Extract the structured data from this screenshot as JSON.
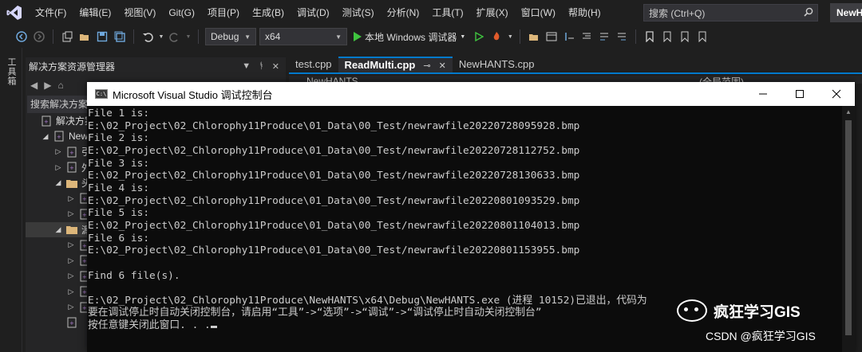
{
  "menubar": {
    "items": [
      "文件(F)",
      "编辑(E)",
      "视图(V)",
      "Git(G)",
      "项目(P)",
      "生成(B)",
      "调试(D)",
      "测试(S)",
      "分析(N)",
      "工具(T)",
      "扩展(X)",
      "窗口(W)",
      "帮助(H)"
    ],
    "search_placeholder": "搜索 (Ctrl+Q)",
    "solution_name": "NewHANTS"
  },
  "toolbar": {
    "config": "Debug",
    "platform": "x64",
    "run_label": "本地 Windows 调试器",
    "icons": [
      "back-icon",
      "forward-icon",
      "new-project-icon",
      "open-icon",
      "save-icon",
      "save-all-icon",
      "undo-icon",
      "redo-icon",
      "start-icon",
      "start-without-debug-icon",
      "hot-reload-icon",
      "bookmark-icon"
    ]
  },
  "left_strip": {
    "label": "工具箱"
  },
  "solution_explorer": {
    "title": "解决方案资源管理器",
    "search_label": "搜索解决方案资源管",
    "tree": [
      {
        "label": "解决方案'",
        "expand": "",
        "indent": 0,
        "selected": false
      },
      {
        "label": "New",
        "expand": "◢",
        "indent": 1,
        "selected": false
      },
      {
        "label": "引",
        "expand": "▷",
        "indent": 2,
        "selected": false
      },
      {
        "label": "外",
        "expand": "▷",
        "indent": 2,
        "selected": false
      },
      {
        "label": "头",
        "expand": "◢",
        "indent": 2,
        "selected": false
      },
      {
        "label": "",
        "expand": "▷",
        "indent": 3,
        "selected": false
      },
      {
        "label": "",
        "expand": "▷",
        "indent": 3,
        "selected": false
      },
      {
        "label": "源",
        "expand": "◢",
        "indent": 2,
        "selected": true
      },
      {
        "label": "",
        "expand": "▷",
        "indent": 3,
        "selected": false
      },
      {
        "label": "",
        "expand": "▷",
        "indent": 3,
        "selected": false
      },
      {
        "label": "",
        "expand": "▷",
        "indent": 3,
        "selected": false
      },
      {
        "label": "",
        "expand": "▷",
        "indent": 3,
        "selected": false
      },
      {
        "label": "",
        "expand": "▷",
        "indent": 3,
        "selected": false
      },
      {
        "label": "",
        "expand": "",
        "indent": 2,
        "selected": false
      }
    ]
  },
  "editor": {
    "tabs": [
      {
        "label": "test.cpp",
        "active": false
      },
      {
        "label": "ReadMulti.cpp",
        "active": true
      },
      {
        "label": "NewHANTS.cpp",
        "active": false
      }
    ],
    "project_label": "NewHANTS",
    "scope_label": "(全局范围)"
  },
  "console": {
    "title": "Microsoft Visual Studio 调试控制台",
    "icon_text": "C:\\",
    "lines": [
      "File 1 is:",
      "E:\\02_Project\\02_Chlorophy11Produce\\01_Data\\00_Test/newrawfile20220728095928.bmp",
      "File 2 is:",
      "E:\\02_Project\\02_Chlorophy11Produce\\01_Data\\00_Test/newrawfile20220728112752.bmp",
      "File 3 is:",
      "E:\\02_Project\\02_Chlorophy11Produce\\01_Data\\00_Test/newrawfile20220728130633.bmp",
      "File 4 is:",
      "E:\\02_Project\\02_Chlorophy11Produce\\01_Data\\00_Test/newrawfile20220801093529.bmp",
      "File 5 is:",
      "E:\\02_Project\\02_Chlorophy11Produce\\01_Data\\00_Test/newrawfile20220801104013.bmp",
      "File 6 is:",
      "E:\\02_Project\\02_Chlorophy11Produce\\01_Data\\00_Test/newrawfile20220801153955.bmp",
      "",
      "Find 6 file(s).",
      "",
      "E:\\02_Project\\02_Chlorophy11Produce\\NewHANTS\\x64\\Debug\\NewHANTS.exe (进程 10152)已退出，代码为",
      "要在调试停止时自动关闭控制台，请启用“工具”->“选项”->“调试”->“调试停止时自动关闭控制台”",
      "按任意键关闭此窗口. . ."
    ]
  },
  "watermark": {
    "name": "疯狂学习GIS",
    "credit": "CSDN @疯狂学习GIS"
  }
}
